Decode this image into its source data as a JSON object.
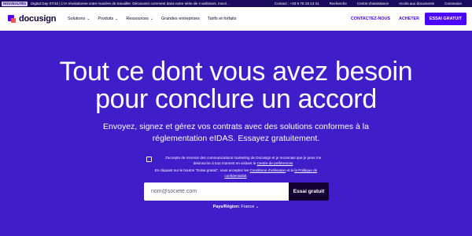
{
  "announcement": {
    "badge": "NOUVEAUTÉS",
    "text": "Digital Day 07/10 | L'IA révolutionne votre manière de travailler. Découvrez comment dans notre série de 4 webinars. Inscrivez...",
    "links": [
      "Contact : +33 9 75 18 13 31",
      "Recherche",
      "Centre d'assistance",
      "Accès aux documents",
      "Connexion"
    ]
  },
  "header": {
    "logo_text": "docusign",
    "nav": [
      {
        "label": "Solutions",
        "chevron": true
      },
      {
        "label": "Produits",
        "chevron": true
      },
      {
        "label": "Ressources",
        "chevron": true
      },
      {
        "label": "Grandes entreprises",
        "chevron": false
      },
      {
        "label": "Tarifs et forfaits",
        "chevron": false
      }
    ],
    "contact_label": "CONTACTEZ-NOUS",
    "buy_label": "ACHETER",
    "trial_label": "ESSAI GRATUIT"
  },
  "hero": {
    "title_line1": "Tout ce dont vous avez besoin",
    "title_line2": "pour conclure un accord",
    "subtitle_line1": "Envoyez, signez et gérez vos contrats avec des solutions conformes à la",
    "subtitle_line2": "réglementation eIDAS. Essayez gratuitement."
  },
  "consent": {
    "text_line1": "J'accepte de recevoir des communications marketing de Docusign et je reconnais que je peux me",
    "text_line2_prefix": "désinscrire à tout moment en visitant le ",
    "text_line2_link": "Centre de préférences"
  },
  "terms": {
    "prefix": "En cliquant sur le bouton \"Essai gratuit\", vous acceptez les ",
    "terms_link": "Conditions d'utilisation",
    "middle": " et la ",
    "privacy_link": "la Politique de confidentialité",
    "suffix": "."
  },
  "form": {
    "email_placeholder": "nom@societe.com",
    "submit_label": "Essai gratuit"
  },
  "region": {
    "label": "Pays/Région:",
    "value": "France"
  },
  "colors": {
    "hero_bg": "#3f1ec9",
    "brand": "#4c00ff",
    "dark": "#130032"
  }
}
